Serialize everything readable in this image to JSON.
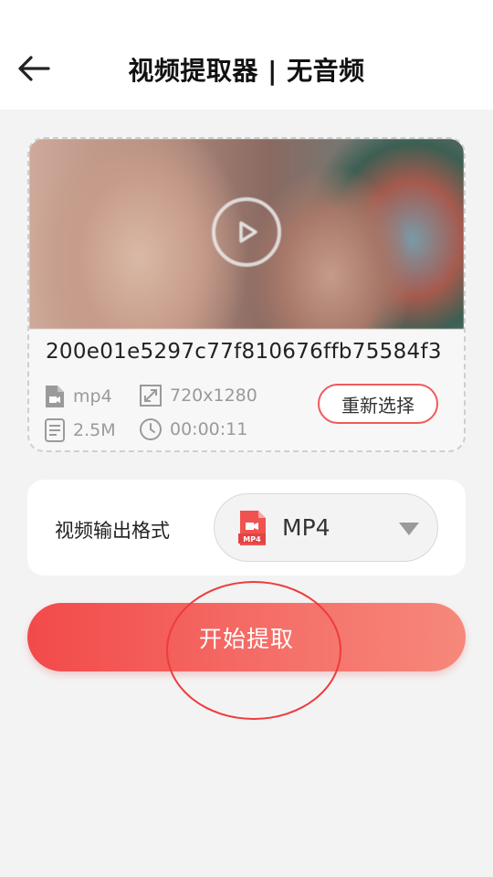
{
  "header": {
    "title": "视频提取器 | 无音频",
    "back_icon": "arrow-left-icon"
  },
  "video": {
    "file_name": "200e01e5297c77f810676ffb75584f3",
    "format": "mp4",
    "resolution": "720x1280",
    "size": "2.5M",
    "duration": "00:00:11",
    "reselect_label": "重新选择",
    "play_icon": "play-circle-icon"
  },
  "output": {
    "label": "视频输出格式",
    "selected_format": "MP4",
    "file_badge": "MP4"
  },
  "action": {
    "start_label": "开始提取"
  },
  "colors": {
    "accent": "#f24a4a",
    "accent_light": "#f6887b",
    "background": "#f3f3f3",
    "muted_text": "#9a9a9a"
  }
}
